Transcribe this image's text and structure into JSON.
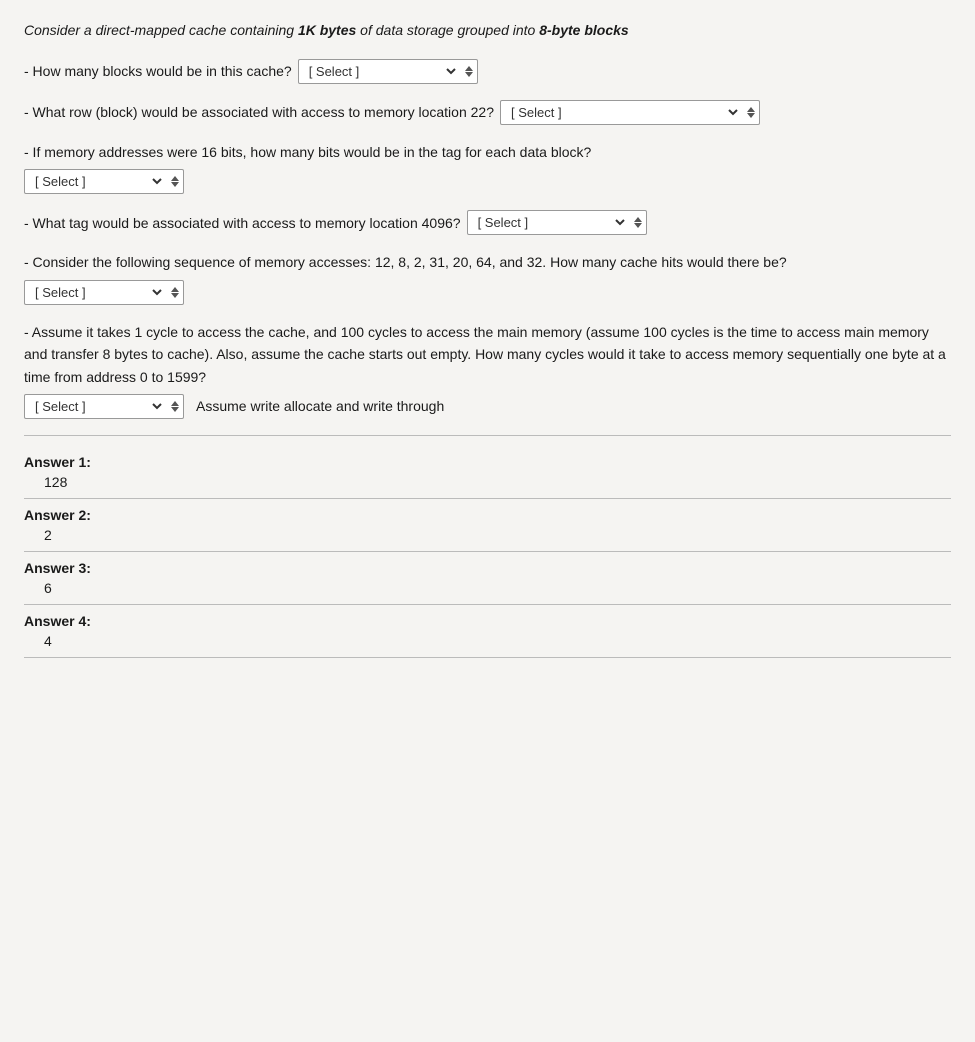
{
  "intro": {
    "text": "Consider a direct-mapped cache containing 1K bytes of data storage grouped into 8-byte blocks",
    "italic_parts": [
      "1K bytes",
      "8-byte blocks"
    ]
  },
  "questions": [
    {
      "id": "q1",
      "label": "- How many blocks would be in this cache?",
      "select_placeholder": "[ Select ]",
      "select_size": "medium"
    },
    {
      "id": "q2",
      "label": "- What row (block) would be associated with access to memory location 22?",
      "select_placeholder": "[ Select ]",
      "select_size": "large"
    },
    {
      "id": "q3",
      "label": "- If memory addresses were 16 bits, how many bits would be in the tag for each data block?",
      "select_placeholder": "[ Select ]",
      "select_size": "small",
      "newline": true
    },
    {
      "id": "q4",
      "label": "- What tag would be associated with access to memory location 4096?",
      "select_placeholder": "[ Select ]",
      "select_size": "medium"
    },
    {
      "id": "q5",
      "label": "- Consider the following sequence of memory accesses: 12, 8, 2, 31, 20, 64, and 32. How many cache hits would there be?",
      "select_placeholder": "[ Select ]",
      "select_size": "small"
    },
    {
      "id": "q6",
      "label": "- Assume it takes 1 cycle to access the cache, and 100 cycles to access the main memory (assume 100 cycles is the time to access main memory and transfer 8 bytes to cache). Also, assume the cache starts out empty. How many cycles would it take to access memory sequentially one byte at a time from address 0 to 1599?",
      "select_placeholder": "[ Select ]",
      "select_size": "small",
      "inline_note": "Assume write allocate and write through"
    }
  ],
  "answers": [
    {
      "label": "Answer 1:",
      "value": "128"
    },
    {
      "label": "Answer 2:",
      "value": "2"
    },
    {
      "label": "Answer 3:",
      "value": "6"
    },
    {
      "label": "Answer 4:",
      "value": "4"
    }
  ]
}
